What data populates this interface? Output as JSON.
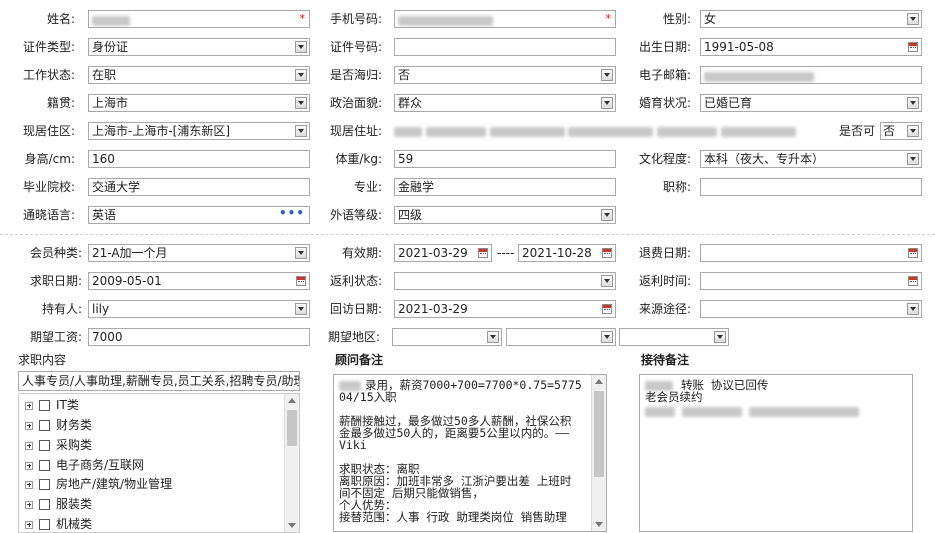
{
  "labels": {
    "name": "姓名:",
    "mobile": "手机号码:",
    "gender": "性别:",
    "id_type": "证件类型:",
    "id_no": "证件号码:",
    "birth": "出生日期:",
    "work_status": "工作状态:",
    "returnee": "是否海归:",
    "email": "电子邮箱:",
    "origin": "籍贯:",
    "political": "政治面貌:",
    "marital": "婚育状况:",
    "residence_area": "现居住区:",
    "address": "现居住址:",
    "contactable": "是否可",
    "height": "身高/cm:",
    "weight": "体重/kg:",
    "education": "文化程度:",
    "school": "毕业院校:",
    "major": "专业:",
    "title": "职称:",
    "language": "通晓语言:",
    "foreign_level": "外语等级:",
    "member_type": "会员种类:",
    "validity": "有效期:",
    "refund_date": "退费日期:",
    "job_date": "求职日期:",
    "rebate_status": "返利状态:",
    "rebate_time": "返利时间:",
    "holder": "持有人:",
    "visit_date": "回访日期:",
    "source": "来源途径:",
    "salary": "期望工资:",
    "area": "期望地区:",
    "validity_sep": "----"
  },
  "values": {
    "name": "",
    "mobile": "",
    "gender": "女",
    "id_type": "身份证",
    "id_no": "",
    "birth": "1991-05-08",
    "work_status": "在职",
    "returnee": "否",
    "email": "",
    "origin": "上海市",
    "political": "群众",
    "marital": "已婚已育",
    "residence_area": "上海市-上海市-[浦东新区]",
    "address": "",
    "contactable": "否",
    "height": "160",
    "weight": "59",
    "education": "本科（夜大、专升本）",
    "school": "交通大学",
    "major": "金融学",
    "title": "",
    "language": "英语",
    "foreign_level": "四级",
    "member_type": "21-A加一个月",
    "validity_start": "2021-03-29",
    "validity_end": "2021-10-28",
    "refund_date": "",
    "job_date": "2009-05-01",
    "rebate_status": "",
    "rebate_time": "",
    "holder": "lily",
    "visit_date": "2021-03-29",
    "source": "",
    "salary": "7000",
    "area1": "",
    "area2": "",
    "area3": ""
  },
  "required_mark": "*",
  "ellipsis": "•••",
  "job_content": {
    "title": "求职内容",
    "value": "人事专员/人事助理,薪酬专员,员工关系,招聘专员/助理",
    "tree": [
      "IT类",
      "财务类",
      "采购类",
      "电子商务/互联网",
      "房地产/建筑/物业管理",
      "服装类",
      "机械类"
    ]
  },
  "consultant_notes": {
    "title": "顾问备注",
    "lines": [
      "录用，薪资7000+700=7700*0.75=5775",
      "04/15入职",
      "",
      "薪酬接触过，最多做过50多人薪酬，社保公积",
      "金最多做过50人的，距离要5公里以内的。——",
      "Viki",
      "",
      "求职状态：离职",
      "离职原因：加班非常多 江浙沪要出差 上班时",
      "间不固定 后期只能做销售，",
      "个人优势：",
      "接替范围：人事 行政 助理类岗位  销售助理"
    ]
  },
  "reception_notes": {
    "title": "接待备注",
    "lines": [
      "转账    协议已回传",
      "老会员续约"
    ]
  }
}
